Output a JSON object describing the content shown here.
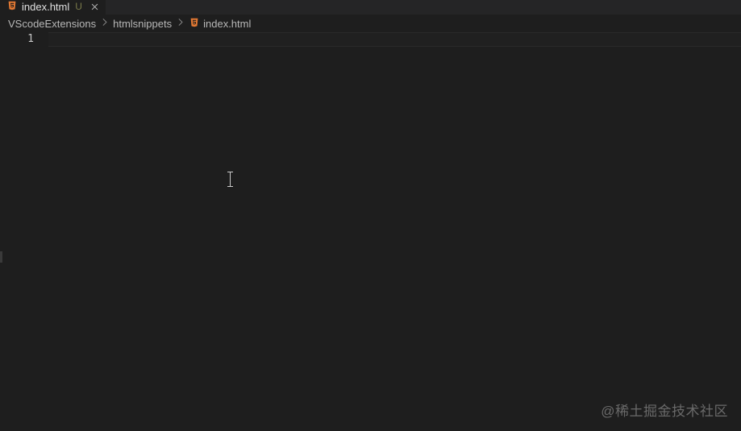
{
  "tab": {
    "filename": "index.html",
    "dirty_marker": "U"
  },
  "breadcrumbs": {
    "root": "VScodeExtensions",
    "folder": "htmlsnippets",
    "file": "index.html"
  },
  "editor": {
    "line_number": "1"
  },
  "watermark": "@稀土掘金技术社区"
}
